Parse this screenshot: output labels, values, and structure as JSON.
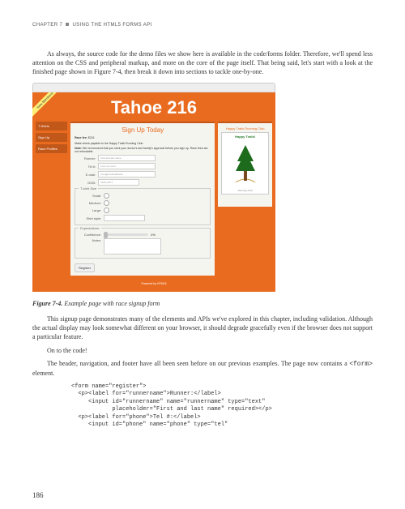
{
  "header": {
    "chapter": "CHAPTER 7",
    "title": "USING THE HTML5 FORMS API"
  },
  "intro": "As always, the source code for the demo files we show here is available in the code/forms folder. Therefore, we'll spend less attention on the CSS and peripheral markup, and more on the core of the page itself. That being said, let's start with a look at the finished page  shown in Figure 7-4, then break it down into sections to tackle one-by-one.",
  "screenshot": {
    "ribbon": "New Members!",
    "title": "Tahoe 216",
    "nav": [
      "T-Shirts",
      "Sign Up",
      "Race Profiles"
    ],
    "form": {
      "heading": "Sign Up Today",
      "fee_label": "Race fee:",
      "fee_value": "$216",
      "line1": "Make check payable to the Happy Trails Running Club.",
      "line2_b": "Note:",
      "line2": " We recommend that you seek your doctor's and family's approval before you sign up. Race fees are not refundable.",
      "fields": {
        "runner": {
          "label": "Runner:",
          "placeholder": "First and last name"
        },
        "tel": {
          "label": "Tel #:",
          "placeholder": "(xxx) xxx-xxxx"
        },
        "email": {
          "label": "E-mail:",
          "placeholder": "your@email.address"
        },
        "dob": {
          "label": "DOB:",
          "placeholder": "10/01/1977"
        }
      },
      "tshirt": {
        "legend": "T-shirt Size",
        "opts": [
          "Small:",
          "Medium:",
          "Large:",
          "Shirt style:"
        ]
      },
      "expect": {
        "legend": "Expectations:",
        "conf_label": "Confidence:",
        "conf_readout": "0%",
        "notes_label": "Notes:"
      },
      "register_btn": "Register"
    },
    "promo": {
      "heading": "Happy Trails Running Club",
      "card_title": "Happy Trails!",
      "card_sub": "Running Club"
    },
    "footer": "Powered by HTML5"
  },
  "caption": {
    "fig": "Figure 7-4.",
    "text": " Example page with race signup form"
  },
  "after1": "This signup page demonstrates many of the elements and APIs we've explored in this chapter, including validation. Although the actual display may look somewhat different on your browser, it should degrade gracefully even if the browser does not support a particular feature.",
  "after2": "On to the code!",
  "after3_a": "The header, navigation, and footer have all been seen before on our previous examples. The page now contains a ",
  "after3_code": "<form>",
  "after3_b": " element.",
  "code": "<form name=\"register\">\n  <p><label for=\"runnername\">Runner:</label>\n     <input id=\"runnername\" name=\"runnername\" type=\"text\"\n            placeholder=\"First and last name\" required></p>\n  <p><label for=\"phone\">Tel #:</label>\n     <input id=\"phone\" name=\"phone\" type=\"tel\"",
  "page_number": "186"
}
